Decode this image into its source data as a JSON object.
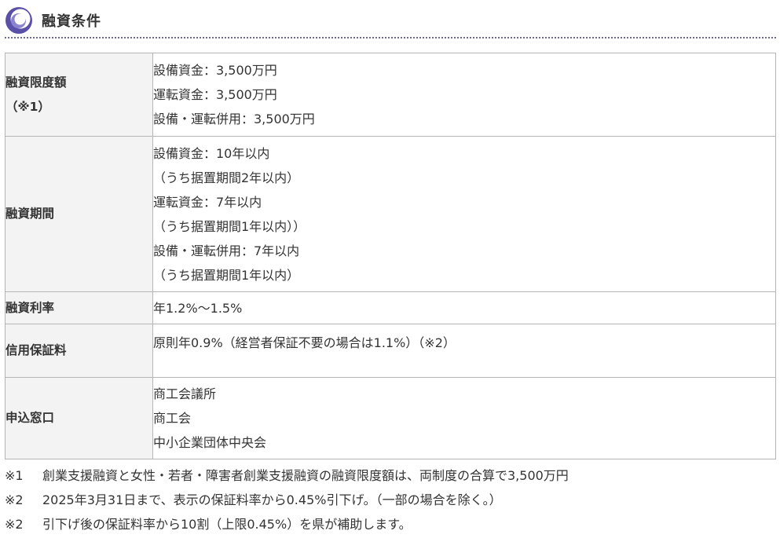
{
  "section": {
    "title": "融資条件",
    "icon": "swirl-icon",
    "accent_color": "#5a50a8"
  },
  "table": {
    "rows": [
      {
        "label_lines": [
          "融資限度額",
          "（※1）"
        ],
        "value_lines": [
          "設備資金：3,500万円",
          "運転資金：3,500万円",
          "設備・運転併用：3,500万円"
        ]
      },
      {
        "label_lines": [
          "融資期間"
        ],
        "value_lines": [
          "設備資金：10年以内",
          "（うち据置期間2年以内）",
          "運転資金：7年以内",
          "（うち据置期間1年以内））",
          "設備・運転併用：7年以内",
          "（うち据置期間1年以内）"
        ]
      },
      {
        "label_lines": [
          "融資利率"
        ],
        "value_lines": [
          "年1.2%～1.5%"
        ]
      },
      {
        "label_lines": [
          "信用保証料"
        ],
        "value_lines": [
          "原則年0.9%（経営者保証不要の場合は1.1%）（※2）"
        ]
      },
      {
        "label_lines": [
          "申込窓口"
        ],
        "value_lines": [
          "商工会議所",
          "商工会",
          "中小企業団体中央会"
        ]
      }
    ]
  },
  "notes": [
    {
      "mark": "※1",
      "text": "創業支援融資と女性・若者・障害者創業支援融資の融資限度額は、両制度の合算で3,500万円"
    },
    {
      "mark": "※2",
      "text": "2025年3月31日まで、表示の保証料率から0.45%引下げ。（一部の場合を除く。）"
    },
    {
      "mark": "※2",
      "text": "引下げ後の保証料率から10割（上限0.45%）を県が補助します。"
    }
  ]
}
